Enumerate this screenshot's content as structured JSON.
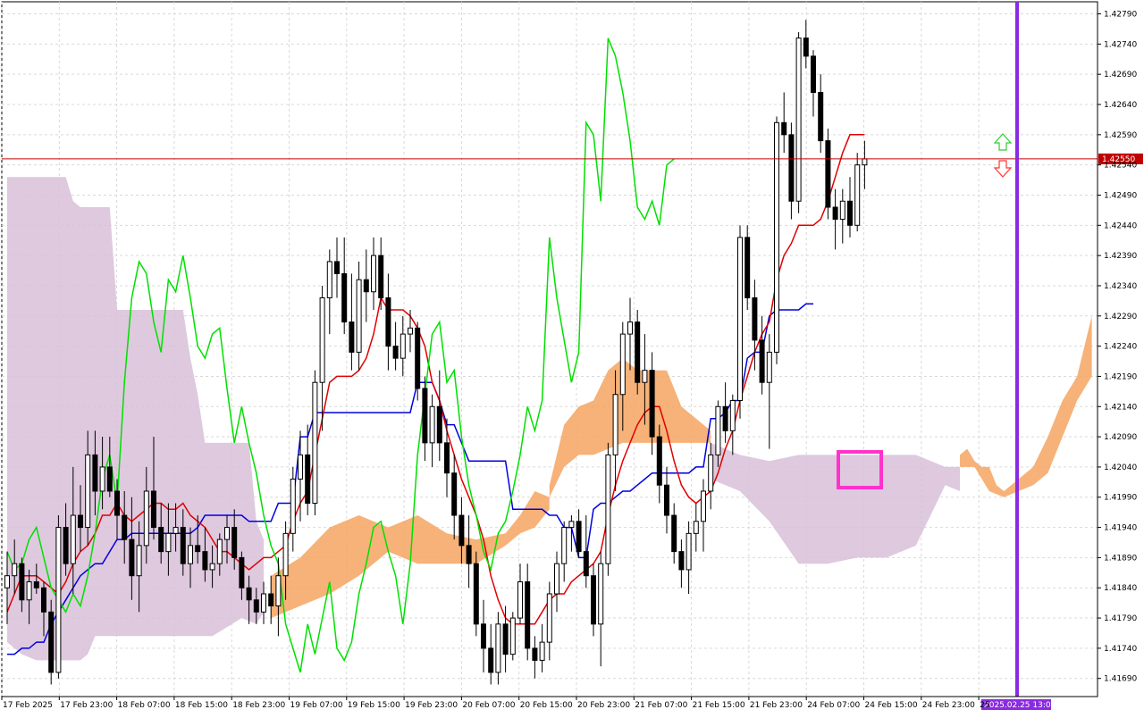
{
  "chart_data": {
    "type": "candlestick",
    "symbol_hidden": true,
    "y_axis": {
      "ticks": [
        "1.42790",
        "1.42740",
        "1.42690",
        "1.42640",
        "1.42590",
        "1.42540",
        "1.42490",
        "1.42440",
        "1.42390",
        "1.42340",
        "1.42290",
        "1.42240",
        "1.42190",
        "1.42140",
        "1.42090",
        "1.42040",
        "1.41990",
        "1.41940",
        "1.41890",
        "1.41840",
        "1.41790",
        "1.41740",
        "1.41690"
      ],
      "range": [
        1.4166,
        1.4281
      ]
    },
    "x_axis": {
      "ticks": [
        "17 Feb 2025",
        "17 Feb 23:00",
        "18 Feb 07:00",
        "18 Feb 15:00",
        "18 Feb 23:00",
        "19 Feb 07:00",
        "19 Feb 15:00",
        "19 Feb 23:00",
        "20 Feb 07:00",
        "20 Feb 15:00",
        "20 Feb 23:00",
        "21 Feb 07:00",
        "21 Feb 15:00",
        "21 Feb 23:00",
        "24 Feb 07:00",
        "24 Feb 15:00",
        "24 Feb 23:00",
        "25"
      ],
      "marker_label": "2025.02.25 13:00"
    },
    "current_price": "1.42550",
    "colors": {
      "tenkan": "#e00000",
      "kijun": "#0000dd",
      "chikou": "#00e000",
      "cloud_bull": "#f4a460",
      "cloud_bear": "#d8bfd8",
      "price_line": "#c00000",
      "vline": "#8a2be2",
      "box": "#ff33cc",
      "arrow_up": "#33cc33",
      "arrow_down": "#ff3333"
    },
    "candles": [
      [
        1.4184,
        1.419,
        1.4178,
        1.4186
      ],
      [
        1.4186,
        1.4192,
        1.4183,
        1.4188
      ],
      [
        1.4188,
        1.4189,
        1.418,
        1.4182
      ],
      [
        1.4182,
        1.4187,
        1.4178,
        1.4185
      ],
      [
        1.4185,
        1.4188,
        1.4183,
        1.4184
      ],
      [
        1.4184,
        1.4185,
        1.4176,
        1.418
      ],
      [
        1.418,
        1.4182,
        1.4168,
        1.417
      ],
      [
        1.417,
        1.4196,
        1.4169,
        1.4194
      ],
      [
        1.4194,
        1.4198,
        1.4186,
        1.4188
      ],
      [
        1.4188,
        1.4204,
        1.4183,
        1.4196
      ],
      [
        1.4196,
        1.4201,
        1.419,
        1.4194
      ],
      [
        1.4194,
        1.421,
        1.4191,
        1.4206
      ],
      [
        1.4206,
        1.421,
        1.4196,
        1.42
      ],
      [
        1.42,
        1.4209,
        1.4197,
        1.4204
      ],
      [
        1.4204,
        1.4209,
        1.4199,
        1.42
      ],
      [
        1.42,
        1.4202,
        1.4192,
        1.4196
      ],
      [
        1.4196,
        1.42,
        1.4188,
        1.4192
      ],
      [
        1.4192,
        1.4199,
        1.4182,
        1.4186
      ],
      [
        1.4186,
        1.4195,
        1.418,
        1.4191
      ],
      [
        1.4191,
        1.4204,
        1.4188,
        1.42
      ],
      [
        1.42,
        1.4209,
        1.4192,
        1.4194
      ],
      [
        1.4194,
        1.4198,
        1.4188,
        1.419
      ],
      [
        1.419,
        1.4198,
        1.4186,
        1.4193
      ],
      [
        1.4193,
        1.4198,
        1.419,
        1.4194
      ],
      [
        1.4194,
        1.4197,
        1.4186,
        1.4188
      ],
      [
        1.4188,
        1.4194,
        1.4184,
        1.4191
      ],
      [
        1.4191,
        1.4196,
        1.4188,
        1.419
      ],
      [
        1.419,
        1.4194,
        1.4185,
        1.4187
      ],
      [
        1.4187,
        1.4191,
        1.4184,
        1.4188
      ],
      [
        1.4188,
        1.4193,
        1.4186,
        1.4192
      ],
      [
        1.4192,
        1.4196,
        1.4188,
        1.4194
      ],
      [
        1.4194,
        1.4197,
        1.4187,
        1.4189
      ],
      [
        1.4189,
        1.419,
        1.4182,
        1.4184
      ],
      [
        1.4184,
        1.4186,
        1.4178,
        1.4182
      ],
      [
        1.4182,
        1.4184,
        1.4178,
        1.418
      ],
      [
        1.418,
        1.4185,
        1.4178,
        1.4183
      ],
      [
        1.4183,
        1.4186,
        1.4178,
        1.4181
      ],
      [
        1.4181,
        1.4189,
        1.4176,
        1.4186
      ],
      [
        1.4186,
        1.4195,
        1.4182,
        1.4193
      ],
      [
        1.4193,
        1.4204,
        1.419,
        1.4202
      ],
      [
        1.4202,
        1.421,
        1.4195,
        1.4206
      ],
      [
        1.4206,
        1.4211,
        1.4196,
        1.4198
      ],
      [
        1.4198,
        1.422,
        1.4196,
        1.4218
      ],
      [
        1.4218,
        1.4234,
        1.421,
        1.4232
      ],
      [
        1.4232,
        1.424,
        1.4226,
        1.4238
      ],
      [
        1.4238,
        1.4242,
        1.4232,
        1.4236
      ],
      [
        1.4236,
        1.4242,
        1.4226,
        1.4228
      ],
      [
        1.4228,
        1.4236,
        1.422,
        1.4223
      ],
      [
        1.4223,
        1.4238,
        1.422,
        1.4235
      ],
      [
        1.4235,
        1.424,
        1.4228,
        1.4233
      ],
      [
        1.4233,
        1.4242,
        1.423,
        1.4239
      ],
      [
        1.4239,
        1.4242,
        1.423,
        1.4232
      ],
      [
        1.4232,
        1.4236,
        1.422,
        1.4224
      ],
      [
        1.4224,
        1.4228,
        1.422,
        1.4222
      ],
      [
        1.4222,
        1.4229,
        1.4219,
        1.4226
      ],
      [
        1.4226,
        1.423,
        1.4223,
        1.4227
      ],
      [
        1.4227,
        1.4228,
        1.4215,
        1.4217
      ],
      [
        1.4217,
        1.4219,
        1.4205,
        1.4208
      ],
      [
        1.4208,
        1.4216,
        1.4204,
        1.4214
      ],
      [
        1.4214,
        1.422,
        1.4205,
        1.4208
      ],
      [
        1.4208,
        1.4212,
        1.4199,
        1.4203
      ],
      [
        1.4203,
        1.4206,
        1.4192,
        1.4196
      ],
      [
        1.4196,
        1.4199,
        1.4188,
        1.4191
      ],
      [
        1.4191,
        1.4196,
        1.4184,
        1.4188
      ],
      [
        1.4188,
        1.419,
        1.4176,
        1.4178
      ],
      [
        1.4178,
        1.4182,
        1.417,
        1.4174
      ],
      [
        1.4174,
        1.4178,
        1.4168,
        1.417
      ],
      [
        1.417,
        1.418,
        1.4168,
        1.4178
      ],
      [
        1.4178,
        1.4181,
        1.417,
        1.4173
      ],
      [
        1.4173,
        1.418,
        1.4172,
        1.4179
      ],
      [
        1.4179,
        1.4188,
        1.4178,
        1.4185
      ],
      [
        1.4185,
        1.4188,
        1.4172,
        1.4174
      ],
      [
        1.4174,
        1.4176,
        1.4169,
        1.4172
      ],
      [
        1.4172,
        1.4178,
        1.417,
        1.4175
      ],
      [
        1.4175,
        1.4185,
        1.4172,
        1.4183
      ],
      [
        1.4183,
        1.419,
        1.418,
        1.4188
      ],
      [
        1.4188,
        1.4195,
        1.4185,
        1.4194
      ],
      [
        1.4194,
        1.4196,
        1.419,
        1.4195
      ],
      [
        1.4195,
        1.4197,
        1.4189,
        1.419
      ],
      [
        1.419,
        1.4196,
        1.4184,
        1.4186
      ],
      [
        1.4186,
        1.4188,
        1.4176,
        1.4178
      ],
      [
        1.4178,
        1.419,
        1.4171,
        1.4188
      ],
      [
        1.4188,
        1.4208,
        1.4186,
        1.4206
      ],
      [
        1.4206,
        1.422,
        1.42,
        1.4216
      ],
      [
        1.4216,
        1.4228,
        1.421,
        1.4226
      ],
      [
        1.4226,
        1.4232,
        1.422,
        1.4228
      ],
      [
        1.4228,
        1.423,
        1.4216,
        1.4218
      ],
      [
        1.4218,
        1.4226,
        1.4211,
        1.422
      ],
      [
        1.422,
        1.4223,
        1.4206,
        1.4209
      ],
      [
        1.4209,
        1.4211,
        1.4198,
        1.4201
      ],
      [
        1.4201,
        1.4204,
        1.4193,
        1.4196
      ],
      [
        1.4196,
        1.4198,
        1.4188,
        1.419
      ],
      [
        1.419,
        1.4192,
        1.4184,
        1.4187
      ],
      [
        1.4187,
        1.4195,
        1.4183,
        1.4193
      ],
      [
        1.4193,
        1.4198,
        1.419,
        1.4195
      ],
      [
        1.4195,
        1.4202,
        1.419,
        1.42
      ],
      [
        1.42,
        1.4208,
        1.4197,
        1.4206
      ],
      [
        1.4206,
        1.4215,
        1.4204,
        1.4214
      ],
      [
        1.4214,
        1.4218,
        1.4208,
        1.421
      ],
      [
        1.421,
        1.4216,
        1.4206,
        1.4215
      ],
      [
        1.4215,
        1.4244,
        1.4212,
        1.4242
      ],
      [
        1.4242,
        1.4244,
        1.423,
        1.4232
      ],
      [
        1.4232,
        1.4235,
        1.422,
        1.4225
      ],
      [
        1.4225,
        1.4229,
        1.4216,
        1.4218
      ],
      [
        1.4218,
        1.4226,
        1.4207,
        1.4223
      ],
      [
        1.4223,
        1.4262,
        1.4221,
        1.4261
      ],
      [
        1.4261,
        1.4266,
        1.4256,
        1.4259
      ],
      [
        1.4259,
        1.4261,
        1.4245,
        1.4248
      ],
      [
        1.4248,
        1.4276,
        1.4246,
        1.4275
      ],
      [
        1.4275,
        1.4278,
        1.427,
        1.4272
      ],
      [
        1.4272,
        1.4273,
        1.4262,
        1.4266
      ],
      [
        1.4266,
        1.4269,
        1.4256,
        1.4258
      ],
      [
        1.4258,
        1.426,
        1.4245,
        1.4247
      ],
      [
        1.4247,
        1.425,
        1.424,
        1.4245
      ],
      [
        1.4245,
        1.425,
        1.4241,
        1.4248
      ],
      [
        1.4248,
        1.4252,
        1.4242,
        1.4244
      ],
      [
        1.4244,
        1.4256,
        1.4243,
        1.4254
      ],
      [
        1.4254,
        1.4258,
        1.425,
        1.4255
      ]
    ],
    "tenkan": [
      1.418,
      1.4183,
      1.4186,
      1.4186,
      1.4186,
      1.4185,
      1.4184,
      1.4183,
      1.4185,
      1.4188,
      1.419,
      1.4191,
      1.4193,
      1.4196,
      1.4196,
      1.4198,
      1.4196,
      1.4195,
      1.4196,
      1.4197,
      1.4198,
      1.4198,
      1.4197,
      1.4197,
      1.4198,
      1.4196,
      1.4195,
      1.4194,
      1.4192,
      1.419,
      1.419,
      1.4189,
      1.4188,
      1.4187,
      1.4188,
      1.4189,
      1.4189,
      1.419,
      1.4191,
      1.4195,
      1.4198,
      1.42,
      1.4206,
      1.4212,
      1.4218,
      1.4219,
      1.4219,
      1.4219,
      1.422,
      1.4222,
      1.4226,
      1.4232,
      1.423,
      1.423,
      1.423,
      1.4229,
      1.4227,
      1.4224,
      1.4218,
      1.4215,
      1.421,
      1.4206,
      1.4202,
      1.4199,
      1.4196,
      1.4192,
      1.4186,
      1.4182,
      1.4179,
      1.4178,
      1.4178,
      1.4178,
      1.4178,
      1.418,
      1.4182,
      1.4183,
      1.4183,
      1.4185,
      1.4186,
      1.4187,
      1.4188,
      1.419,
      1.4196,
      1.4201,
      1.4205,
      1.4208,
      1.4211,
      1.4213,
      1.4214,
      1.4214,
      1.421,
      1.4205,
      1.4201,
      1.4199,
      1.4198,
      1.4199,
      1.42,
      1.4203,
      1.4207,
      1.421,
      1.4215,
      1.4219,
      1.4223,
      1.4226,
      1.4228,
      1.4235,
      1.4239,
      1.4241,
      1.4244,
      1.4244,
      1.4244,
      1.4245,
      1.4248,
      1.4252,
      1.4256,
      1.4259,
      1.4259,
      1.4259
    ],
    "kijun": [
      1.4173,
      1.4173,
      1.4174,
      1.4174,
      1.4175,
      1.4175,
      1.4178,
      1.418,
      1.4182,
      1.4184,
      1.4186,
      1.4187,
      1.4188,
      1.4188,
      1.419,
      1.4192,
      1.4192,
      1.4193,
      1.4193,
      1.4193,
      1.4193,
      1.4193,
      1.4193,
      1.4193,
      1.4193,
      1.4193,
      1.4194,
      1.4196,
      1.4196,
      1.4196,
      1.4196,
      1.4196,
      1.4196,
      1.4195,
      1.4195,
      1.4195,
      1.4195,
      1.4198,
      1.4198,
      1.4198,
      1.4209,
      1.4209,
      1.4213,
      1.4213,
      1.4213,
      1.4213,
      1.4213,
      1.4213,
      1.4213,
      1.4213,
      1.4213,
      1.4213,
      1.4213,
      1.4213,
      1.4213,
      1.4213,
      1.4218,
      1.4218,
      1.4218,
      1.4215,
      1.4211,
      1.4211,
      1.4208,
      1.4205,
      1.4205,
      1.4205,
      1.4205,
      1.4205,
      1.4205,
      1.4197,
      1.4197,
      1.4197,
      1.4197,
      1.4197,
      1.4196,
      1.4196,
      1.4194,
      1.4194,
      1.4189,
      1.4189,
      1.4197,
      1.4198,
      1.4198,
      1.4199,
      1.42,
      1.42,
      1.4201,
      1.4202,
      1.4203,
      1.4203,
      1.4203,
      1.4203,
      1.4203,
      1.4203,
      1.4204,
      1.4204,
      1.4212,
      1.4212,
      1.4213,
      1.4215,
      1.4215,
      1.4222,
      1.4223,
      1.4223,
      1.4229,
      1.423,
      1.423,
      1.423,
      1.423,
      1.4231,
      1.4231
    ]
  }
}
